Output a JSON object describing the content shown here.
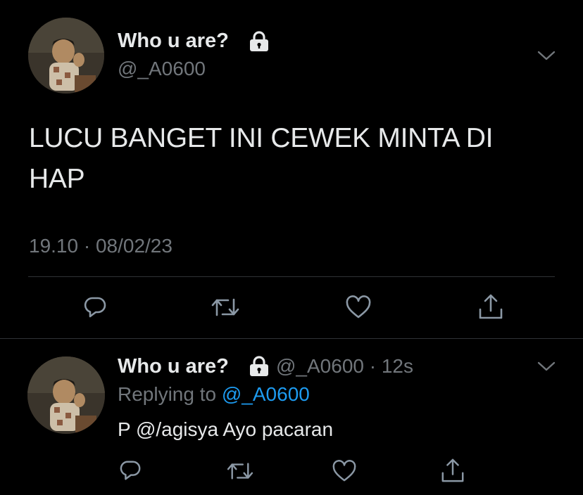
{
  "main_tweet": {
    "display_name": "Who u are?",
    "lock_icon": "lock-icon",
    "handle": "@_A0600",
    "text": "LUCU BANGET INI CEWEK MINTA DI HAP",
    "timestamp": "19.10 · 08/02/23",
    "actions": [
      "reply-icon",
      "retweet-icon",
      "like-icon",
      "share-icon"
    ]
  },
  "reply_tweet": {
    "display_name": "Who u are?",
    "handle": "@_A0600",
    "separator": "·",
    "time": "12s",
    "replying_prefix": "Replying to",
    "replying_to": "@_A0600",
    "text": "P @/agisya Ayo pacaran",
    "actions": [
      "reply-icon",
      "retweet-icon",
      "like-icon",
      "share-icon"
    ]
  },
  "colors": {
    "background": "#000000",
    "text": "#e7e9ea",
    "secondary": "#71767b",
    "link": "#1d9bf0",
    "divider": "#2f3336"
  }
}
